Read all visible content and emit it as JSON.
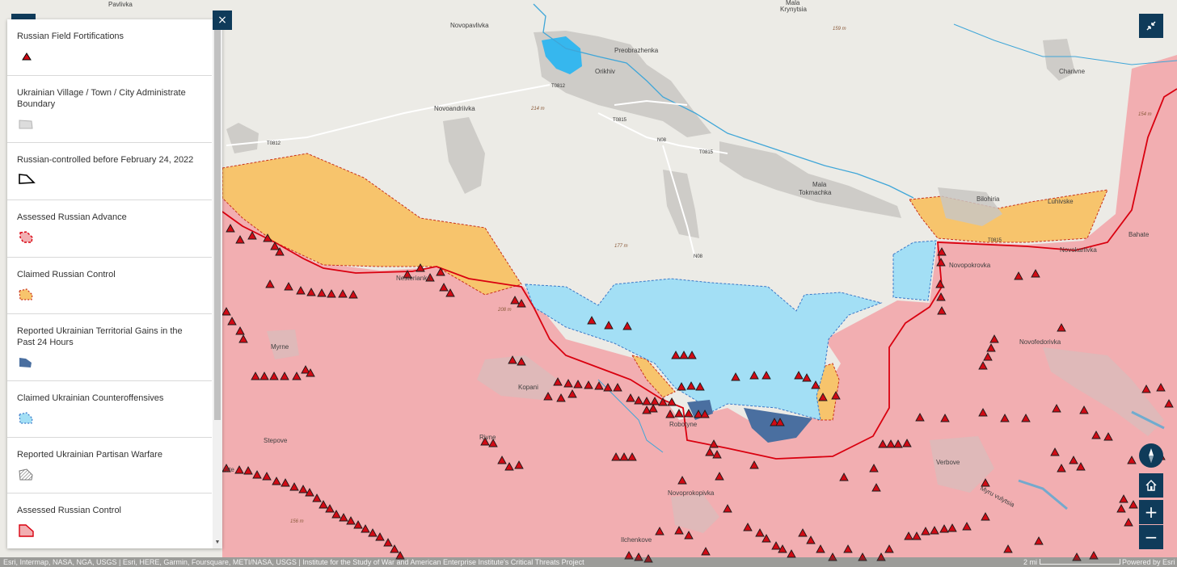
{
  "legend": {
    "items": [
      {
        "label": "Russian Field Fortifications",
        "swatch": "triangle"
      },
      {
        "label": "Ukrainian Village / Town / City Administrate Boundary",
        "swatch": "boundary"
      },
      {
        "label": "Russian-controlled before February 24, 2022",
        "swatch": "pre2022"
      },
      {
        "label": "Assessed Russian Advance",
        "swatch": "advance"
      },
      {
        "label": "Claimed Russian Control",
        "swatch": "claimed-ru"
      },
      {
        "label": "Reported Ukrainian Territorial Gains in the Past 24 Hours",
        "swatch": "ua-gains"
      },
      {
        "label": "Claimed Ukrainian Counteroffensives",
        "swatch": "claimed-ua"
      },
      {
        "label": "Reported Ukrainian Partisan Warfare",
        "swatch": "partisan"
      },
      {
        "label": "Assessed Russian Control",
        "swatch": "assessed-ru"
      }
    ],
    "close_label": "×"
  },
  "map": {
    "places": {
      "pavlivka": "Pavlivka",
      "novopavlivka": "Novopavlivka",
      "preobrazhenka": "Preobrazhenka",
      "orikhiv": "Orikhiv",
      "mala_krynytsia": "Mala",
      "krynytsia": "Krynytsia",
      "novoandriivka": "Novoandriivka",
      "charivne": "Charivne",
      "mala_tokmachka_1": "Mala",
      "mala_tokmachka_2": "Tokmachka",
      "bilohiria": "Bilohiria",
      "luhivske": "Luhivske",
      "novopokrovka": "Novopokrovka",
      "novokarlivka": "Novokarlivka",
      "bahate": "Bahate",
      "nesterianka": "Nesterianka",
      "myrne": "Myrne",
      "kopani": "Kopani",
      "robotyne": "Robotyne",
      "novofedorivka": "Novofedorivka",
      "stepove": "Stepove",
      "rivne": "Rivne",
      "verbove": "Verbove",
      "novoprokopivka": "Novoprokopivka",
      "ilchenkove": "Ilchenkove",
      "rate": "rate",
      "myru_vulytsia": "Myru vulytsia"
    },
    "roads": {
      "t0812a": "T0812",
      "t0812b": "T0812",
      "t0815a": "T0815",
      "t0815b": "T0815",
      "t0815c": "T0815",
      "n08a": "N08",
      "n08b": "N08"
    },
    "elevations": {
      "e159": "159 m",
      "e214": "214 m",
      "e177": "177 m",
      "e208": "208 m",
      "e156": "156 m",
      "e154": "154 m"
    },
    "colors": {
      "assessed_russian_control": "#f2aeb1",
      "claimed_russian_control": "#f7c46c",
      "claimed_ukrainian_counteroffensives": "#a3dff5",
      "ukrainian_gains_24h": "#4a6fa0",
      "frontline": "#d9000f",
      "fortification": "#d10a14",
      "water": "#3fa6d8",
      "urban": "#c9c7c3",
      "control_button": "#0f3b5a"
    }
  },
  "controls": {
    "compass_icon": "compass-icon",
    "home_icon": "home-icon",
    "zoom_in": "+",
    "zoom_out": "−"
  },
  "attribution": {
    "text": "Esri, Intermap, NASA, NGA, USGS | Esri, HERE, Garmin, Foursquare, METI/NASA, USGS | Institute for the Study of War and American Enterprise Institute's Critical Threats Project",
    "scale": "2 mi",
    "powered": "Powered by Esri"
  }
}
